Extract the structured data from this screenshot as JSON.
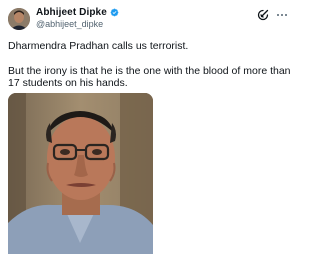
{
  "tweet": {
    "author": {
      "display_name": "Abhijeet Dipke",
      "handle": "@abhijeet_dipke",
      "verified": true,
      "avatar_icon": "profile-photo"
    },
    "text_line1": "Dharmendra Pradhan calls us terrorist.",
    "text_para2": "But the irony is that he is the one with the blood of more than 17 students on his hands.",
    "media": {
      "type": "photo",
      "description_icon": "photo-man-with-glasses"
    }
  },
  "actions": {
    "grok_icon": "grok-icon",
    "more_icon": "more-options-icon"
  },
  "colors": {
    "text_primary": "#0f1419",
    "text_secondary": "#536471",
    "verified_blue": "#1d9bf0"
  }
}
